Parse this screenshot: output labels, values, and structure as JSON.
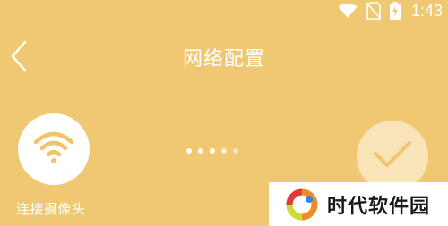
{
  "status_bar": {
    "time": "1:43",
    "icons": [
      "wifi-icon",
      "no-sim-icon",
      "battery-charging-icon"
    ]
  },
  "header": {
    "back_icon": "chevron-left-icon",
    "title": "网络配置"
  },
  "steps": {
    "first": {
      "icon": "wifi-icon",
      "label": "连接摄像头"
    },
    "last": {
      "icon": "checkmark-icon"
    },
    "progress_dots": 5
  },
  "watermark": {
    "logo_icon": "brand-logo-icon",
    "text": "时代软件园"
  },
  "colors": {
    "background": "#f0c872",
    "accent": "#efc46b",
    "white": "#ffffff"
  }
}
